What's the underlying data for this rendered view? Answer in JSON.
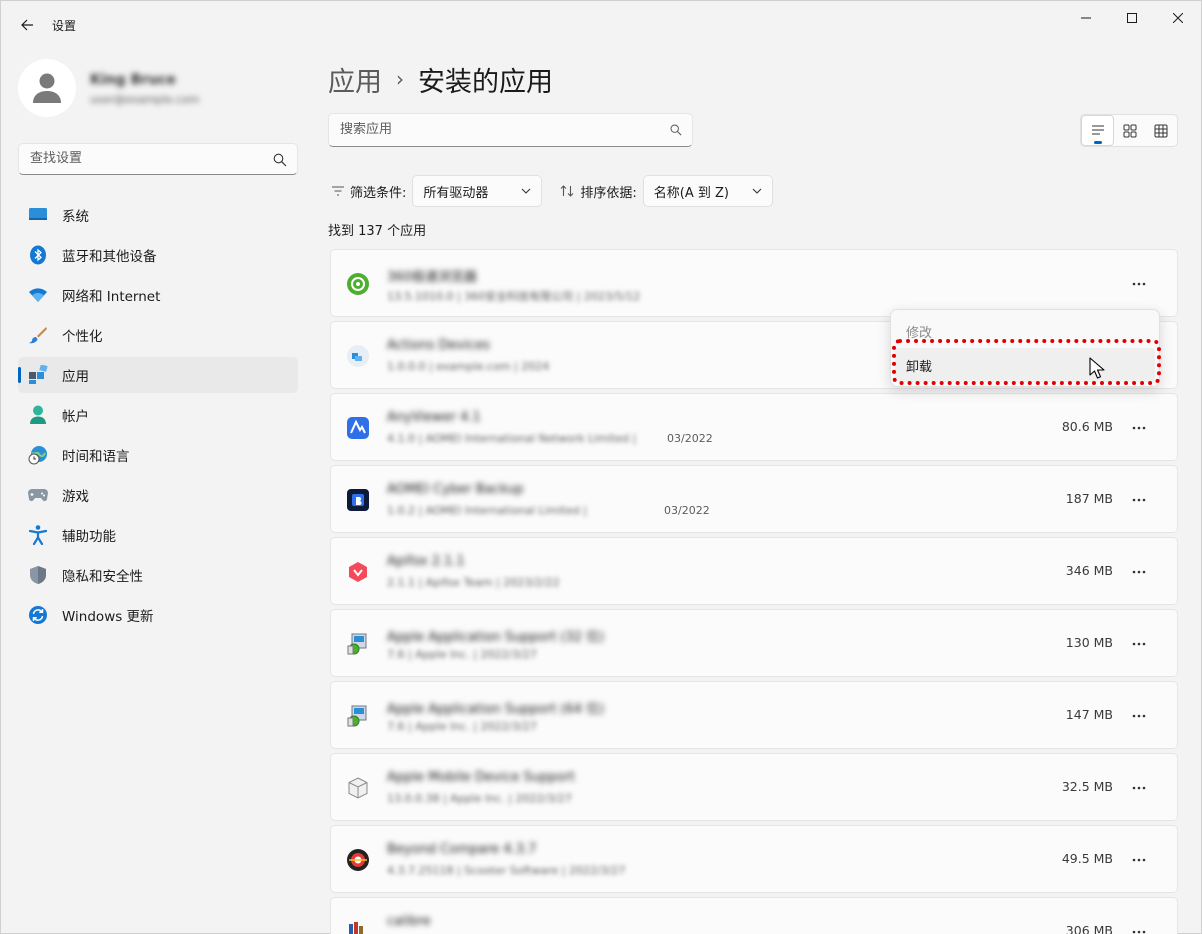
{
  "window": {
    "title": "设置",
    "controls": [
      "minimize",
      "maximize",
      "close"
    ]
  },
  "profile": {
    "name": "King Bruce",
    "email": "user@example.com"
  },
  "sidebar": {
    "search_placeholder": "查找设置",
    "items": [
      {
        "label": "系统",
        "icon": "monitor-icon",
        "active": false
      },
      {
        "label": "蓝牙和其他设备",
        "icon": "bluetooth-icon",
        "active": false
      },
      {
        "label": "网络和 Internet",
        "icon": "wifi-icon",
        "active": false
      },
      {
        "label": "个性化",
        "icon": "brush-icon",
        "active": false
      },
      {
        "label": "应用",
        "icon": "apps-icon",
        "active": true
      },
      {
        "label": "帐户",
        "icon": "person-icon",
        "active": false
      },
      {
        "label": "时间和语言",
        "icon": "globe-clock-icon",
        "active": false
      },
      {
        "label": "游戏",
        "icon": "gamepad-icon",
        "active": false
      },
      {
        "label": "辅助功能",
        "icon": "accessibility-icon",
        "active": false
      },
      {
        "label": "隐私和安全性",
        "icon": "shield-icon",
        "active": false
      },
      {
        "label": "Windows 更新",
        "icon": "update-icon",
        "active": false
      }
    ]
  },
  "header": {
    "parent": "应用",
    "separator": "›",
    "current": "安装的应用"
  },
  "search": {
    "placeholder": "搜索应用"
  },
  "filter": {
    "label": "筛选条件:",
    "value": "所有驱动器"
  },
  "sort": {
    "label": "排序依据:",
    "value": "名称(A 到 Z)"
  },
  "found_text": "找到 137 个应用",
  "apps": [
    {
      "name": "360极速浏览器",
      "meta": "13.5.1010.0 | 360安全科技有限公司 | 2023/5/12",
      "meta_tail": "",
      "size": "",
      "icon": "green-app-icon"
    },
    {
      "name": "Actions Devices",
      "meta": "1.0.0.0 | example.com | 2024",
      "meta_tail": "",
      "size": "",
      "icon": "windows-app-icon"
    },
    {
      "name": "AnyViewer 4.1",
      "meta": "4.1.0 | AOMEI International Network Limited | ",
      "meta_tail": "03/2022",
      "size": "80.6 MB",
      "icon": "anyviewer-icon"
    },
    {
      "name": "AOMEI Cyber Backup",
      "meta": "1.0.2 | AOMEI International Limited | ",
      "meta_tail": "03/2022",
      "size": "187 MB",
      "icon": "backup-app-icon"
    },
    {
      "name": "Apifox 2.1.1",
      "meta": "2.1.1 | Apifox Team | 2023/2/22",
      "meta_tail": "",
      "size": "346 MB",
      "icon": "apifox-icon"
    },
    {
      "name": "Apple Application Support (32 位)",
      "meta": "7.6 | Apple Inc. | 2022/3/27",
      "meta_tail": "",
      "size": "130 MB",
      "icon": "installer-icon"
    },
    {
      "name": "Apple Application Support (64 位)",
      "meta": "7.6 | Apple Inc. | 2022/3/27",
      "meta_tail": "",
      "size": "147 MB",
      "icon": "installer-icon"
    },
    {
      "name": "Apple Mobile Device Support",
      "meta": "13.0.0.38 | Apple Inc. | 2022/3/27",
      "meta_tail": "",
      "size": "32.5 MB",
      "icon": "box-icon"
    },
    {
      "name": "Beyond Compare 4.3.7",
      "meta": "4.3.7.25118 | Scooter Software | 2022/3/27",
      "meta_tail": "",
      "size": "49.5 MB",
      "icon": "compare-icon"
    },
    {
      "name": "calibre",
      "meta": "",
      "meta_tail": "",
      "size": "306 MB",
      "icon": "books-icon"
    }
  ],
  "context_menu": {
    "items": [
      {
        "label": "修改",
        "disabled": true
      },
      {
        "label": "卸载",
        "disabled": false
      }
    ]
  },
  "colors": {
    "accent": "#0067c0",
    "highlight": "#e00000",
    "background": "#f3f3f3"
  }
}
